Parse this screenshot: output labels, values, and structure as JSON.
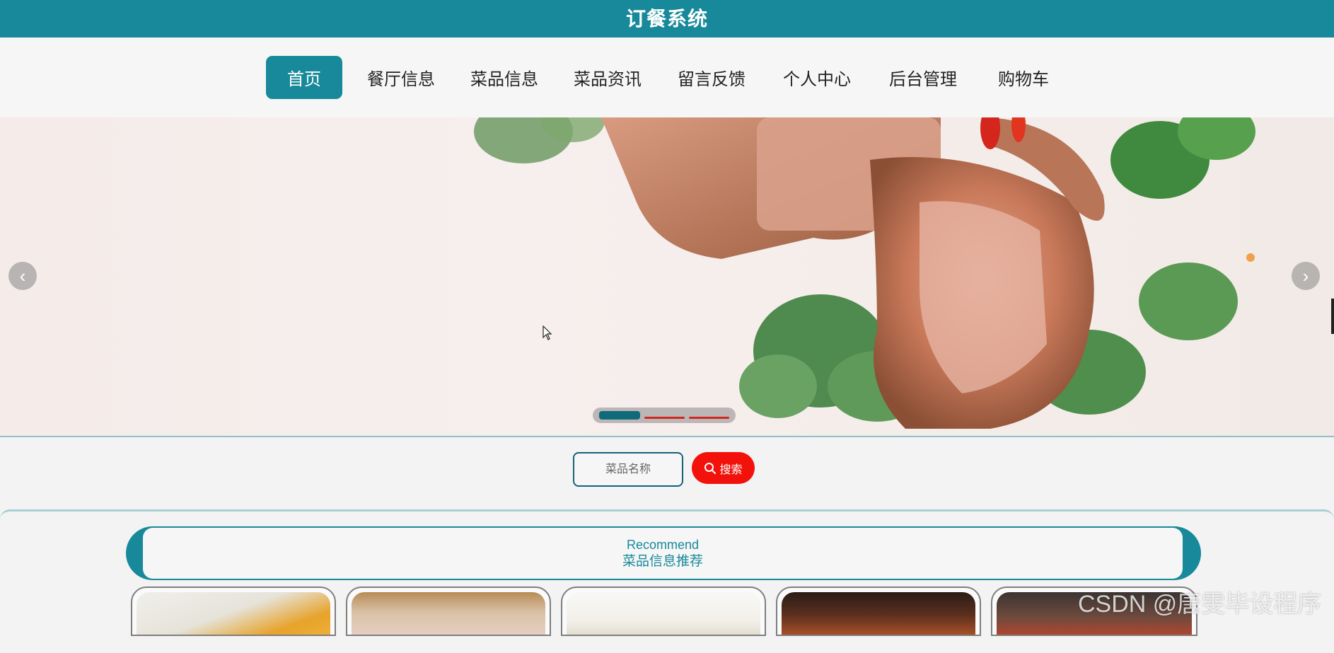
{
  "app": {
    "title": "订餐系统"
  },
  "nav": {
    "items": [
      {
        "label": "首页",
        "active": true
      },
      {
        "label": "餐厅信息"
      },
      {
        "label": "菜品信息"
      },
      {
        "label": "菜品资讯"
      },
      {
        "label": "留言反馈"
      },
      {
        "label": "个人中心"
      },
      {
        "label": "后台管理"
      },
      {
        "label": "购物车"
      }
    ]
  },
  "carousel": {
    "prev_icon": "chevron-left-icon",
    "next_icon": "chevron-right-icon",
    "active_index": 0,
    "slide_count": 3
  },
  "search": {
    "placeholder": "菜品名称",
    "button_label": "搜索",
    "button_icon": "search-icon"
  },
  "recommend": {
    "title_en": "Recommend",
    "title_cn": "菜品信息推荐"
  },
  "watermark": "CSDN @唐雯毕设程序",
  "colors": {
    "primary": "#18899a",
    "search_button": "#f2120b",
    "indicator_active": "#0f6a7a",
    "indicator_inactive": "#d2261f"
  }
}
